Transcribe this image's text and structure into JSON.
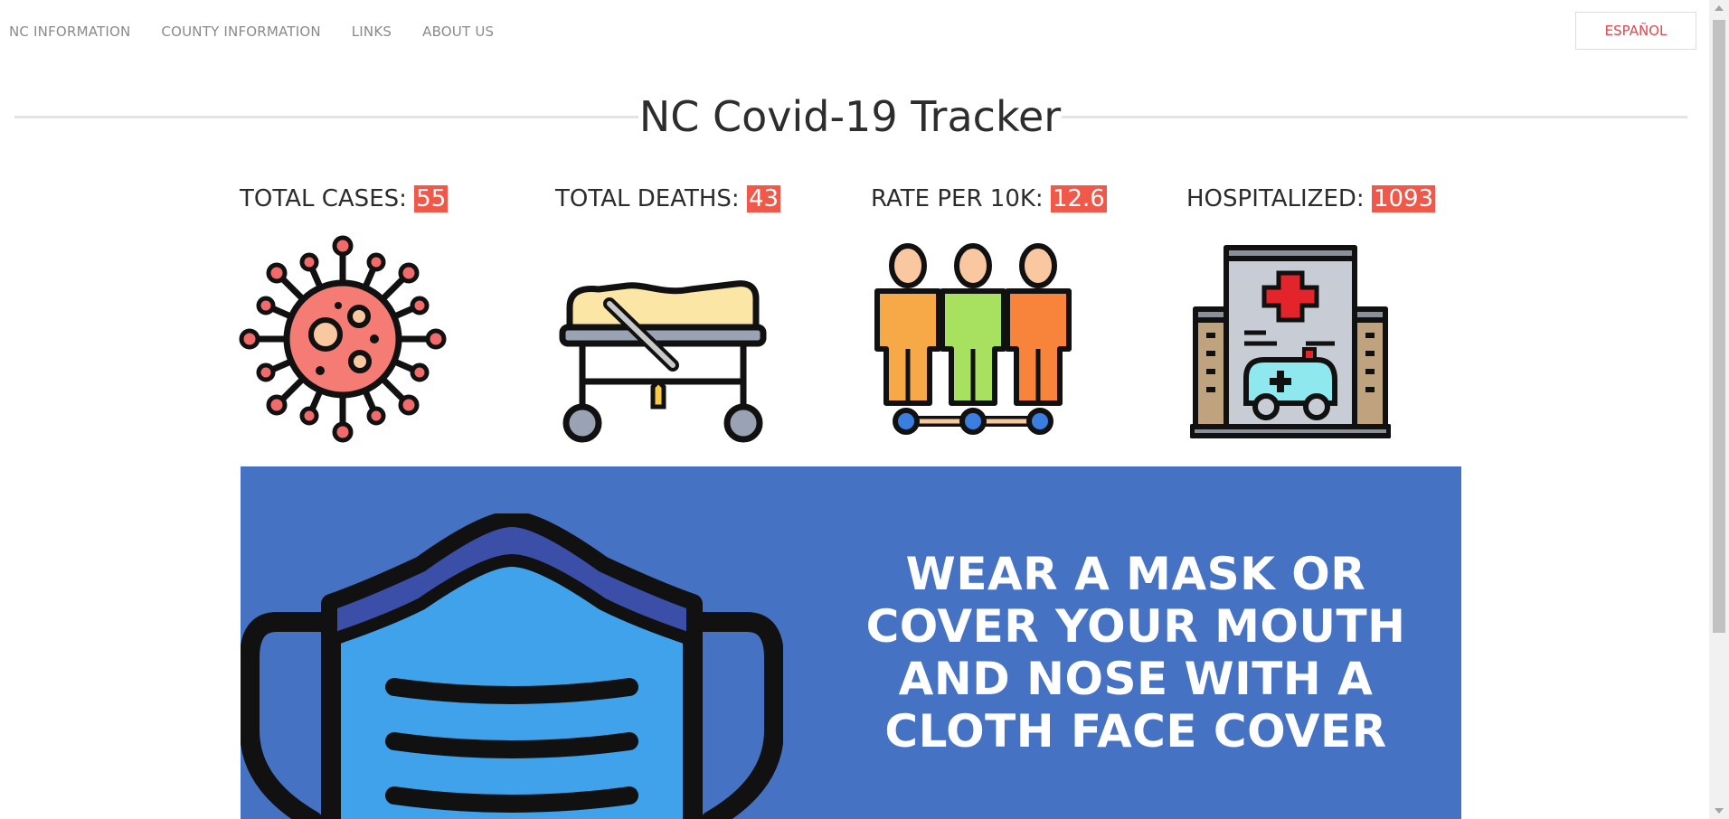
{
  "nav": {
    "links": [
      "NC INFORMATION",
      "COUNTY INFORMATION",
      "LINKS",
      "ABOUT US"
    ],
    "language_button": "ESPAÑOL"
  },
  "header": {
    "title": "NC Covid-19 Tracker"
  },
  "stats": [
    {
      "label": "TOTAL CASES: ",
      "value": "55",
      "icon": "virus-icon"
    },
    {
      "label": "TOTAL DEATHS: ",
      "value": "43",
      "icon": "stretcher-icon"
    },
    {
      "label": "RATE PER 10K: ",
      "value": "12.6",
      "icon": "people-icon"
    },
    {
      "label": "HOSPITALIZED: ",
      "value": "1093",
      "icon": "hospital-icon"
    }
  ],
  "banner": {
    "lines": [
      "WEAR A MASK OR",
      "COVER YOUR MOUTH",
      "AND NOSE WITH A",
      "CLOTH FACE COVER"
    ],
    "icon": "face-mask-icon"
  },
  "colors": {
    "accent": "#f0584a",
    "banner_bg": "#4672c4",
    "language_text": "#e0464b"
  }
}
